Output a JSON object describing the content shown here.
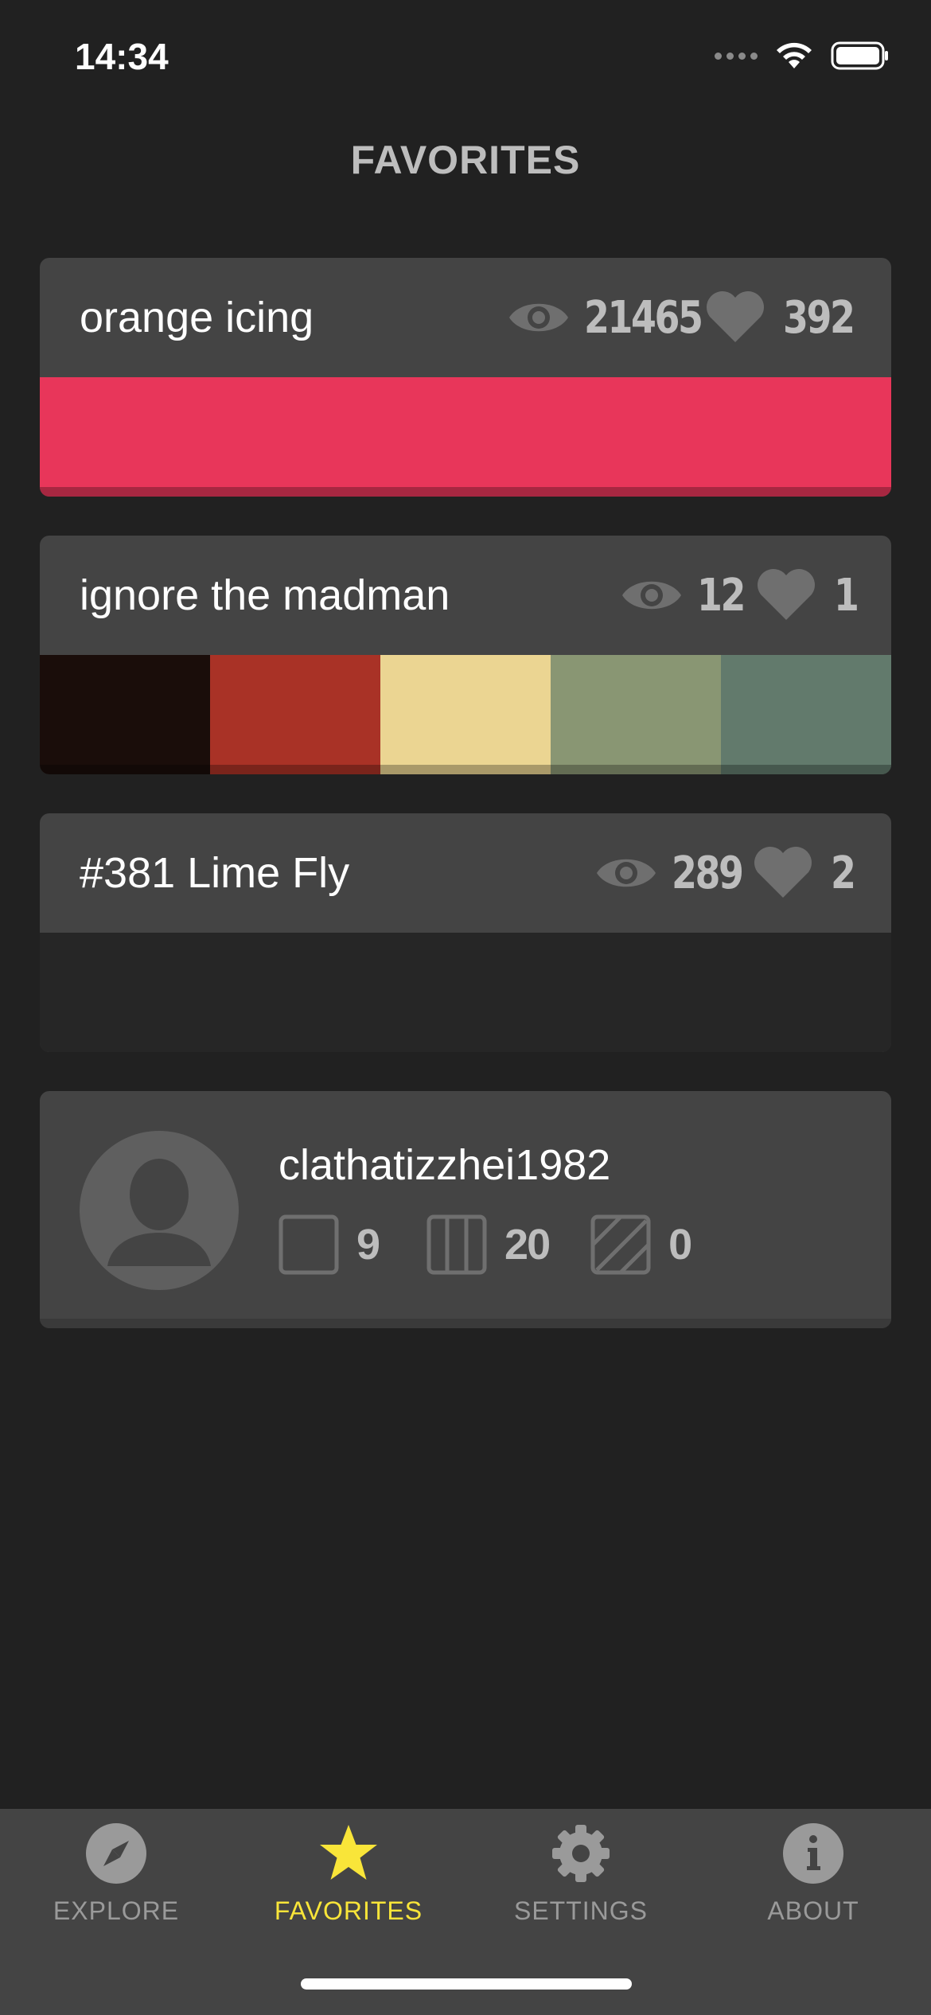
{
  "status": {
    "time": "14:34"
  },
  "header": {
    "title": "FAVORITES"
  },
  "palettes": [
    {
      "title": "orange icing",
      "views": "21465",
      "likes": "392",
      "colors": [
        "#e8365a"
      ]
    },
    {
      "title": "ignore the madman",
      "views": "12",
      "likes": "1",
      "colors": [
        "#1a0d0a",
        "#a93226",
        "#ebd592",
        "#899673",
        "#627a6c"
      ]
    },
    {
      "title": "#381 Lime Fly",
      "views": "289",
      "likes": "2",
      "colors": []
    }
  ],
  "profile": {
    "username": "clathatizzhei1982",
    "colors": "9",
    "palettes": "20",
    "patterns": "0"
  },
  "tabs": [
    {
      "label": "EXPLORE",
      "icon": "compass-icon",
      "active": false
    },
    {
      "label": "FAVORITES",
      "icon": "star-icon",
      "active": true
    },
    {
      "label": "SETTINGS",
      "icon": "gear-icon",
      "active": false
    },
    {
      "label": "ABOUT",
      "icon": "info-icon",
      "active": false
    }
  ],
  "theme": {
    "accent": "#f9e539",
    "background": "#212121",
    "card": "#444444",
    "muted": "#bdbdbd"
  }
}
